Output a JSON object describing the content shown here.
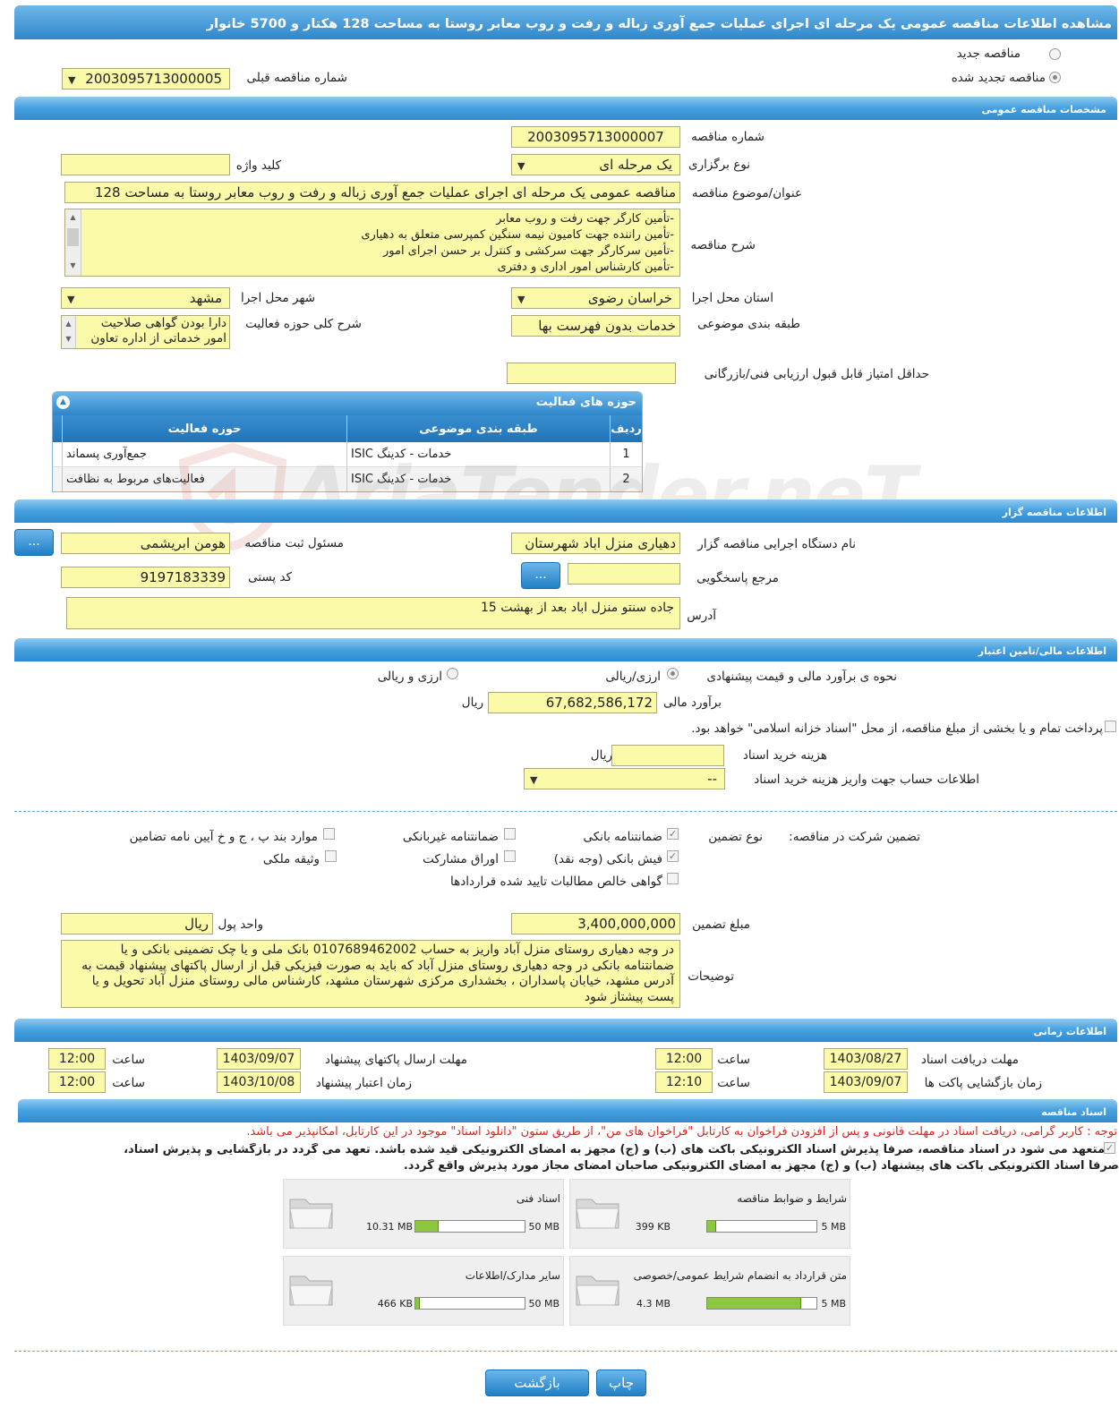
{
  "header": {
    "title": "مشاهده اطلاعات مناقصه عمومی یک مرحله ای اجرای عملیات جمع آوری زباله و رفت و روب معابر روستا به مساحت 128 هکتار و 5700 خانوار"
  },
  "tender_mode": {
    "new_label": "مناقصه جدید",
    "renewed_label": "مناقصه تجدید شده",
    "previous_number_label": "شماره مناقصه قبلی",
    "previous_number_value": "2003095713000005"
  },
  "general": {
    "section_title": "مشخصات مناقصه عمومی",
    "number_label": "شماره مناقصه",
    "number_value": "2003095713000007",
    "type_label": "نوع برگزاری",
    "type_value": "یک مرحله ای",
    "keyword_label": "کلید واژه",
    "keyword_value": "",
    "subject_label": "عنوان/موضوع مناقصه",
    "subject_value": "مناقصه عمومی یک مرحله ای اجرای عملیات جمع آوری زباله و رفت و روب معابر روستا به مساحت 128",
    "description_label": "شرح مناقصه",
    "description_lines": [
      "-تأمین کارگر جهت رفت و روب معابر",
      "-تأمین راننده جهت کامیون نیمه سنگین کمپرسی متعلق به دهیاری",
      "-تأمین سرکارگر جهت سرکشی و کنترل بر حسن اجرای امور",
      "-تأمین کارشناس امور اداری و دفتری"
    ],
    "province_label": "استان محل اجرا",
    "province_value": "خراسان رضوی",
    "city_label": "شهر محل اجرا",
    "city_value": "مشهد",
    "category_label": "طبقه بندی موضوعی",
    "category_value": "خدمات بدون فهرست بها",
    "activity_desc_label": "شرح کلی حوزه فعالیت",
    "activity_desc_lines": [
      "دارا بودن گواهی صلاحیت",
      "امور خدماتی از اداره تعاون"
    ],
    "min_score_label": "حداقل امتیاز قابل قبول ارزیابی فنی/بازرگانی",
    "min_score_value": ""
  },
  "activity_grid": {
    "title": "حوزه های فعالیت",
    "headers": {
      "row": "ردیف",
      "category": "طبقه بندی موضوعی",
      "field": "حوزه فعالیت"
    },
    "rows": [
      {
        "row": "1",
        "category": "خدمات - کدینگ ISIC",
        "field": "جمع‌آوری پسماند"
      },
      {
        "row": "2",
        "category": "خدمات - کدینگ ISIC",
        "field": "فعالیت‌های مربوط به نظافت"
      }
    ]
  },
  "watermark": {
    "text": "AriaTender.neT"
  },
  "organizer": {
    "section_title": "اطلاعات مناقصه گزار",
    "org_label": "نام دستگاه اجرایی مناقصه گزار",
    "org_value": "دهیاری منزل اباد شهرستان",
    "responsible_label": "مسئول ثبت مناقصه",
    "responsible_value": "هومن ابریشمی",
    "more_button": "...",
    "reference_label": "مرجع پاسخگویی",
    "reference_value": "",
    "postal_label": "کد پستی",
    "postal_value": "9197183339",
    "address_label": "آدرس",
    "address_value": "جاده سنتو منزل اباد بعد از بهشت 15"
  },
  "financial": {
    "section_title": "اطلاعات مالی/تامین اعتبار",
    "estimate_method_label": "نحوه ی برآورد مالی و قیمت پیشنهادی",
    "option_rial": "ارزی/ریالی",
    "option_currency": "ارزی و ریالی",
    "estimate_label": "برآورد مالی",
    "estimate_value": "67,682,586,172",
    "rial_unit": "ریال",
    "treasury_text": "پرداخت تمام و یا بخشی از مبلغ مناقصه، از محل \"اسناد خزانه اسلامی\" خواهد بود.",
    "doc_cost_label": "هزینه خرید اسناد",
    "doc_cost_value": "",
    "account_label": "اطلاعات حساب جهت واریز هزینه خرید اسناد",
    "account_value": "--"
  },
  "guarantee": {
    "participation_label": "تضمین شرکت در مناقصه:",
    "type_label": "نوع تضمین",
    "options": {
      "bank_guarantee": "ضمانتنامه بانکی",
      "non_bank_guarantee": "ضمانتنامه غیربانکی",
      "clauses": "موارد بند پ ، ج و خ آیین نامه تضامین",
      "bank_receipt": "فیش بانکی (وجه نقد)",
      "bonds": "اوراق مشارکت",
      "property": "وثیقه ملکی",
      "receivables": "گواهی خالص مطالبات تایید شده قراردادها"
    },
    "amount_label": "مبلغ تضمین",
    "amount_value": "3,400,000,000",
    "currency_label": "واحد پول",
    "currency_value": "ریال",
    "notes_label": "توضیحات",
    "notes_value": "در وجه دهیاری روستای منزل آباد واریز به حساب 0107689462002 بانک ملی و یا چک تضمینی بانکی و یا ضمانتنامه بانکی در وجه دهیاری روستای منزل آباد که باید به صورت فیزیکی قبل از ارسال پاکتهای پیشنهاد قیمت به آدرس مشهد، خیابان پاسداران ، بخشداری مرکزی شهرستان مشهد، کارشناس مالی روستای منزل آباد تحویل و یا پست پیشتاز شود"
  },
  "timing": {
    "section_title": "اطلاعات زمانی",
    "doc_receive_label": "مهلت دریافت اسناد",
    "doc_receive_date": "1403/08/27",
    "doc_receive_time": "12:00",
    "send_label": "مهلت ارسال پاکتهای پیشنهاد",
    "send_date": "1403/09/07",
    "send_time": "12:00",
    "open_label": "زمان بازگشایی پاکت ها",
    "open_date": "1403/09/07",
    "open_time": "12:10",
    "validity_label": "زمان اعتبار پیشنهاد",
    "validity_date": "1403/10/08",
    "validity_time": "12:00",
    "time_label": "ساعت"
  },
  "documents": {
    "section_title": "اسناد مناقصه",
    "notice": "توجه : کاربر گرامی، دریافت اسناد در مهلت قانونی و پس از افزودن فراخوان به کارتابل \"فراخوان های من\"، از طریق ستون \"دانلود اسناد\" موجود در این کارتابل، امکانپذیر می باشد.",
    "commitment_line1": "متعهد می شود در اسناد مناقصه، صرفاً پذیرش اسناد الکترونیکی باکت های (ب) و (ج) مجهز به امضای الکترونیکی قید شده باشد. تعهد می گردد در بازگشایی و پذیرش اسناد،",
    "commitment_line2": "صرفاً اسناد الکترونیکی باکت های پیشنهاد (ب) و (ج) مجهز به امضای الکترونیکی صاحبان امضای مجاز مورد پذیرش واقع گردد.",
    "items": [
      {
        "name": "شرایط و ضوابط مناقصه",
        "size": "399 KB",
        "max": "5 MB",
        "fraction": 0.08
      },
      {
        "name": "اسناد فنی",
        "size": "10.31 MB",
        "max": "50 MB",
        "fraction": 0.21
      },
      {
        "name": "متن قرارداد به انضمام شرایط عمومی/خصوصی",
        "size": "4.3 MB",
        "max": "5 MB",
        "fraction": 0.86
      },
      {
        "name": "سایر مدارک/اطلاعات",
        "size": "466 KB",
        "max": "50 MB",
        "fraction": 0.01
      }
    ]
  },
  "footer": {
    "print_button": "چاپ",
    "back_button": "بازگشت"
  },
  "colors": {
    "accent": "#2f87c9",
    "input_bg": "#fafaa8",
    "warning": "#e02020",
    "progress": "#8dc63f"
  }
}
